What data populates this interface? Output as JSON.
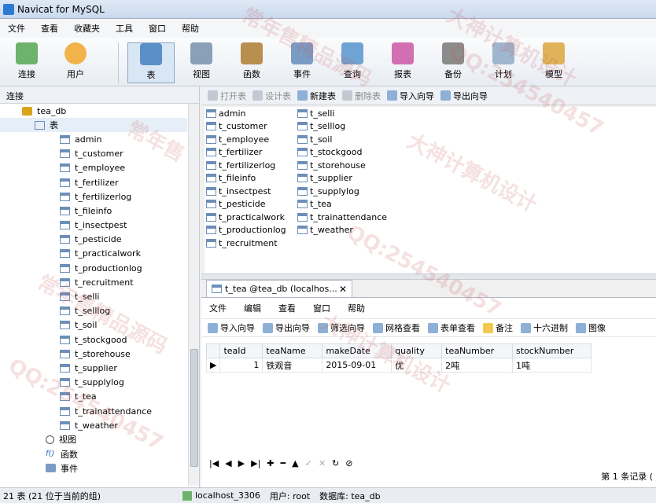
{
  "window": {
    "title": "Navicat for MySQL"
  },
  "menu": {
    "items": [
      "文件",
      "查看",
      "收藏夹",
      "工具",
      "窗口",
      "帮助"
    ]
  },
  "toolbar": {
    "buttons": [
      {
        "id": "connect",
        "label": "连接",
        "icon": "plug-icon"
      },
      {
        "id": "user",
        "label": "用户",
        "icon": "user-icon"
      },
      {
        "id": "table",
        "label": "表",
        "icon": "table-icon"
      },
      {
        "id": "view",
        "label": "视图",
        "icon": "view-icon"
      },
      {
        "id": "function",
        "label": "函数",
        "icon": "function-icon"
      },
      {
        "id": "event",
        "label": "事件",
        "icon": "event-icon"
      },
      {
        "id": "query",
        "label": "查询",
        "icon": "query-icon"
      },
      {
        "id": "report",
        "label": "报表",
        "icon": "report-icon"
      },
      {
        "id": "backup",
        "label": "备份",
        "icon": "backup-icon"
      },
      {
        "id": "schedule",
        "label": "计划",
        "icon": "schedule-icon"
      },
      {
        "id": "model",
        "label": "模型",
        "icon": "model-icon"
      }
    ]
  },
  "left_pane": {
    "header": "连接",
    "db_name": "tea_db",
    "tables_label": "表",
    "tables": [
      "admin",
      "t_customer",
      "t_employee",
      "t_fertilizer",
      "t_fertilizerlog",
      "t_fileinfo",
      "t_insectpest",
      "t_pesticide",
      "t_practicalwork",
      "t_productionlog",
      "t_recruitment",
      "t_selli",
      "t_selllog",
      "t_soil",
      "t_stockgood",
      "t_storehouse",
      "t_supplier",
      "t_supplylog",
      "t_tea",
      "t_trainattendance",
      "t_weather"
    ],
    "views_label": "视图",
    "functions_label": "函数",
    "events_label": "事件"
  },
  "object_toolbar": {
    "open": "打开表",
    "design": "设计表",
    "new": "新建表",
    "delete": "删除表",
    "import": "导入向导",
    "export": "导出向导"
  },
  "object_list": {
    "col1": [
      "admin",
      "t_customer",
      "t_employee",
      "t_fertilizer",
      "t_fertilizerlog",
      "t_fileinfo",
      "t_insectpest",
      "t_pesticide",
      "t_practicalwork",
      "t_productionlog",
      "t_recruitment"
    ],
    "col2": [
      "t_selli",
      "t_selllog",
      "t_soil",
      "t_stockgood",
      "t_storehouse",
      "t_supplier",
      "t_supplylog",
      "t_tea",
      "t_trainattendance",
      "t_weather"
    ]
  },
  "doc_tab": {
    "label": "t_tea @tea_db (localhos..."
  },
  "editor": {
    "menu": [
      "文件",
      "编辑",
      "查看",
      "窗口",
      "帮助"
    ],
    "tools": [
      "导入向导",
      "导出向导",
      "筛选向导",
      "网格查看",
      "表单查看",
      "备注",
      "十六进制",
      "图像"
    ],
    "columns": [
      "teaId",
      "teaName",
      "makeDate",
      "quality",
      "teaNumber",
      "stockNumber"
    ],
    "rows": [
      [
        "1",
        "铁观音",
        "2015-09-01",
        "优",
        "2吨",
        "1吨"
      ]
    ],
    "record_status": "第 1 条记录 ("
  },
  "status": {
    "left": "21 表 (21 位于当前的组)",
    "connection": "localhost_3306",
    "user": "用户: root",
    "database": "数据库: tea_db"
  },
  "watermarks": [
    "常年售",
    "大神计算机设计",
    "QQ:254540457",
    "常年售精品源码",
    "大神计算机设计",
    "QQ:254540457",
    "常年售精品源码",
    "大神计算机设计",
    "QQ:254540457"
  ],
  "colors": {
    "accent": "#2b7bd5",
    "toolbar_active": "#d9e6f4"
  }
}
